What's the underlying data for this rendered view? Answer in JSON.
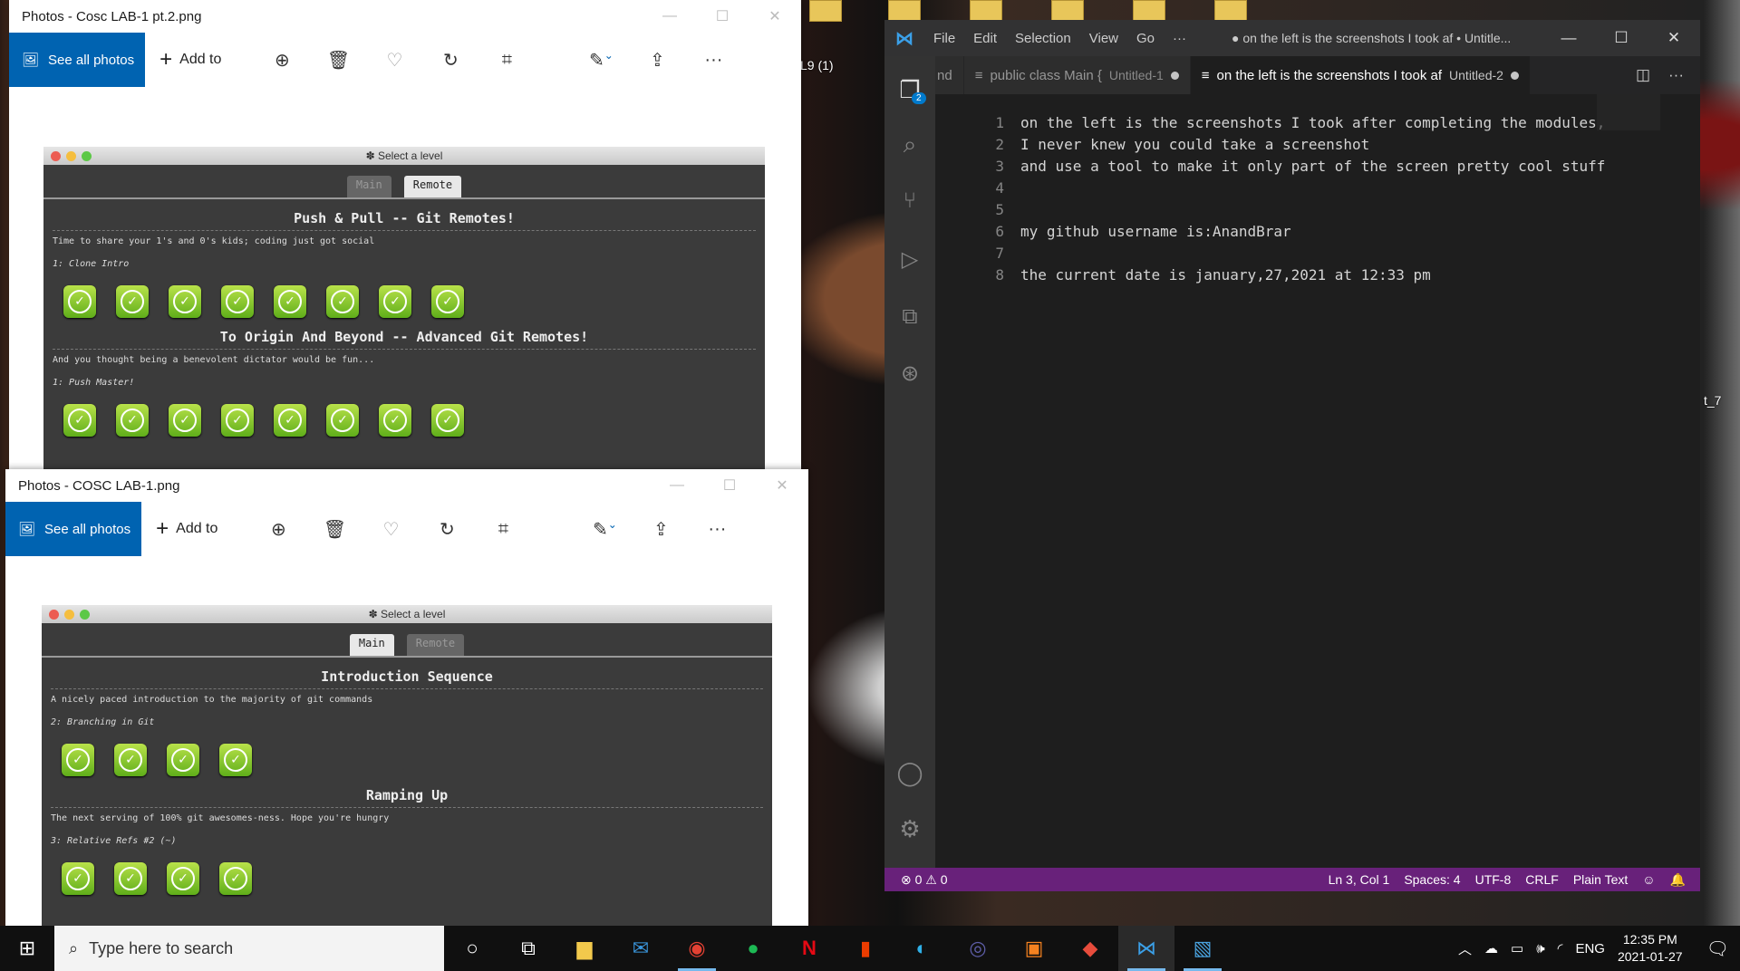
{
  "desktop": {
    "label_l9": "L9 (1)",
    "label_t7": "t_7"
  },
  "photos1": {
    "title": "Photos - Cosc LAB-1 pt.2.png",
    "see_all": "See all photos",
    "add_to": "Add to",
    "image": {
      "window_title": "✽ Select a level",
      "tabs": [
        "Main",
        "Remote"
      ],
      "sections": [
        {
          "title": "Push & Pull -- Git Remotes!",
          "desc": "Time to share your 1's and 0's kids; coding just got social",
          "sub": "1: Clone Intro"
        },
        {
          "title": "To Origin And Beyond -- Advanced Git Remotes!",
          "desc": "And you thought being a benevolent dictator would be fun...",
          "sub": "1: Push Master!"
        }
      ]
    }
  },
  "photos2": {
    "title": "Photos - COSC LAB-1.png",
    "see_all": "See all photos",
    "add_to": "Add to",
    "image": {
      "window_title": "✽ Select a level",
      "tabs": [
        "Main",
        "Remote"
      ],
      "sections": [
        {
          "title": "Introduction Sequence",
          "desc": "A nicely paced introduction to the majority of git commands",
          "sub": "2: Branching in Git"
        },
        {
          "title": "Ramping Up",
          "desc": "The next serving of 100% git awesomes-ness. Hope you're hungry",
          "sub": "3: Relative Refs #2 (~)"
        }
      ]
    }
  },
  "vscode": {
    "menu": [
      "File",
      "Edit",
      "Selection",
      "View",
      "Go",
      "···"
    ],
    "window_title": "● on the left is the screenshots I took af • Untitle...",
    "tabs": [
      {
        "label": "nd",
        "sub": ""
      },
      {
        "label": "public class Main {",
        "sub": "Untitled-1"
      },
      {
        "label": "on the left is the screenshots I took af",
        "sub": "Untitled-2"
      }
    ],
    "lines": [
      {
        "n": "1",
        "text": "on the left is the screenshots I took after completing the modules,"
      },
      {
        "n": "2",
        "text": "I never knew you could take a screenshot"
      },
      {
        "n": "3",
        "text": "and use a tool to make it only part of the screen pretty cool stuff"
      },
      {
        "n": "4",
        "text": ""
      },
      {
        "n": "5",
        "text": ""
      },
      {
        "n": "6",
        "text": "my github username is:AnandBrar"
      },
      {
        "n": "7",
        "text": ""
      },
      {
        "n": "8",
        "text": "the current date is january,27,2021 at 12:33 pm"
      }
    ],
    "explorer_badge": "2",
    "status": {
      "problems": "⊗ 0 ⚠ 0",
      "position": "Ln 3, Col 1",
      "spaces": "Spaces: 4",
      "encoding": "UTF-8",
      "eol": "CRLF",
      "language": "Plain Text"
    }
  },
  "taskbar": {
    "search_placeholder": "Type here to search",
    "lang": "ENG",
    "time": "12:35 PM",
    "date": "2021-01-27"
  },
  "colors": {
    "photos_accent": "#0063b1",
    "vscode_status": "#68217a",
    "check_green": "#5fae1a"
  }
}
